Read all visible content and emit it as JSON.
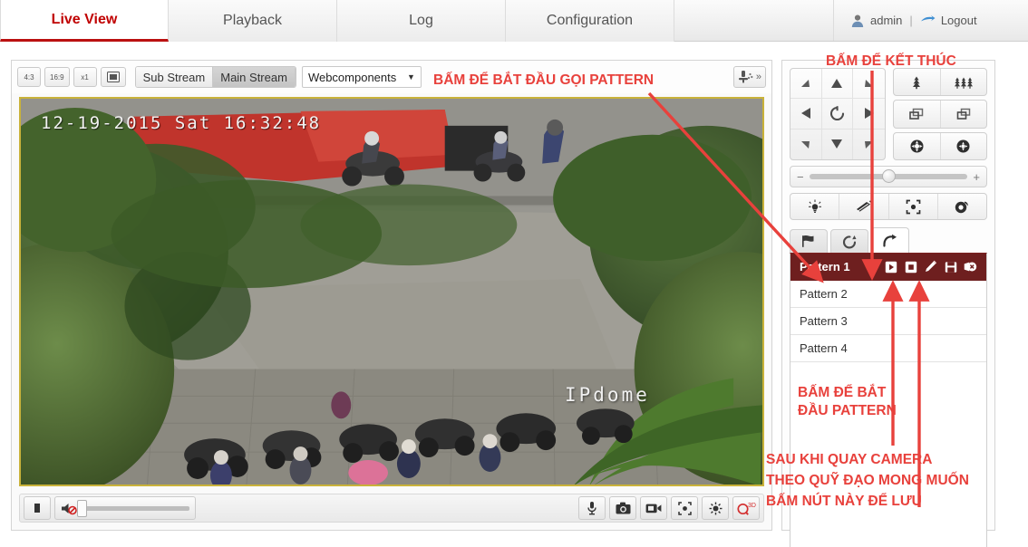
{
  "nav": {
    "tabs": [
      {
        "label": "Live View",
        "active": true
      },
      {
        "label": "Playback",
        "active": false
      },
      {
        "label": "Log",
        "active": false
      },
      {
        "label": "Configuration",
        "active": false
      }
    ],
    "user": "admin",
    "separator": "|",
    "logout": "Logout",
    "user_icon": "user-avatar-icon",
    "logout_icon": "logout-arrow-icon",
    "active_color": "#c00000"
  },
  "stream_toolbar": {
    "ratio_4_3": "4:3",
    "ratio_16_9": "16:9",
    "ratio_x1": "x1",
    "fullscreen_icon": "fullscreen-icon",
    "sub_stream": "Sub Stream",
    "main_stream": "Main Stream",
    "selected_stream": "Main Stream",
    "plugin": "Webcomponents",
    "plugin_caret": "▼",
    "ptz_toggle_icon": "ptz-control-icon",
    "ptz_expand": "»"
  },
  "video": {
    "timestamp": "12-19-2015 Sat 16:32:48",
    "watermark": "IPdome",
    "border_color": "#c9b23a"
  },
  "video_controls": {
    "stop": "stop-icon",
    "speaker": "speaker-mute-icon",
    "volume_value": 0,
    "audio_in": "microphone-icon",
    "capture": "snapshot-camera-icon",
    "record": "record-video-icon",
    "zoom_region": "digital-zoom-icon",
    "lens": "lens-adjust-icon",
    "q3d_label": "Q",
    "q3d_sup": "3D",
    "q3d_color": "#d32f2f"
  },
  "ptz": {
    "dpad": [
      {
        "name": "up-left-arrow",
        "glyph": "◢"
      },
      {
        "name": "up-arrow",
        "glyph": "▲"
      },
      {
        "name": "up-right-arrow",
        "glyph": "◣"
      },
      {
        "name": "left-arrow",
        "glyph": "◀"
      },
      {
        "name": "auto-scan-icon",
        "glyph": "↺"
      },
      {
        "name": "right-arrow",
        "glyph": "▶"
      },
      {
        "name": "down-left-arrow",
        "glyph": "◥"
      },
      {
        "name": "down-arrow",
        "glyph": "▼"
      },
      {
        "name": "down-right-arrow",
        "glyph": "◤"
      }
    ],
    "zoom_out": "zoom-out-icon",
    "zoom_in": "zoom-in-icon",
    "focus_near": "focus-near-icon",
    "focus_far": "focus-far-icon",
    "iris_close": "iris-close-icon",
    "iris_open": "iris-open-icon",
    "speed_minus": "−",
    "speed_plus": "+",
    "speed_value": 46,
    "aux": [
      {
        "name": "light-icon"
      },
      {
        "name": "wiper-icon"
      },
      {
        "name": "auto-focus-icon"
      },
      {
        "name": "lens-initialization-icon"
      }
    ],
    "tabs": [
      {
        "name": "preset-tab",
        "icon": "flag-icon",
        "active": false
      },
      {
        "name": "patrol-tab",
        "icon": "patrol-loop-icon",
        "active": false
      },
      {
        "name": "pattern-tab",
        "icon": "pattern-arrow-icon",
        "active": true
      }
    ],
    "selected_color": "#6e1f1f",
    "patterns": [
      {
        "label": "Pattern 1",
        "selected": true
      },
      {
        "label": "Pattern 2",
        "selected": false
      },
      {
        "label": "Pattern 3",
        "selected": false
      },
      {
        "label": "Pattern 4",
        "selected": false
      }
    ],
    "pattern_actions": [
      {
        "name": "pattern-call-play-button",
        "icon": "play-icon"
      },
      {
        "name": "pattern-stop-button",
        "icon": "stop-square-icon"
      },
      {
        "name": "pattern-record-start-button",
        "icon": "pencil-icon"
      },
      {
        "name": "pattern-save-button",
        "icon": "floppy-save-icon"
      },
      {
        "name": "pattern-delete-button",
        "icon": "delete-icon"
      }
    ]
  },
  "annotations": {
    "color": "#e8413c",
    "call_pattern": "BẤM ĐỂ BẮT ĐẦU GỌI PATTERN",
    "finish": "BẤM ĐỂ KẾT THÚC",
    "start_pattern_line1": "BẤM ĐỂ BẮT",
    "start_pattern_line2": "ĐẦU PATTERN",
    "save_line1": "SAU KHI QUAY CAMERA",
    "save_line2": "THEO QUỸ ĐẠO MONG MUỐN",
    "save_line3": "BẤM NÚT NÀY ĐỂ LƯU"
  }
}
